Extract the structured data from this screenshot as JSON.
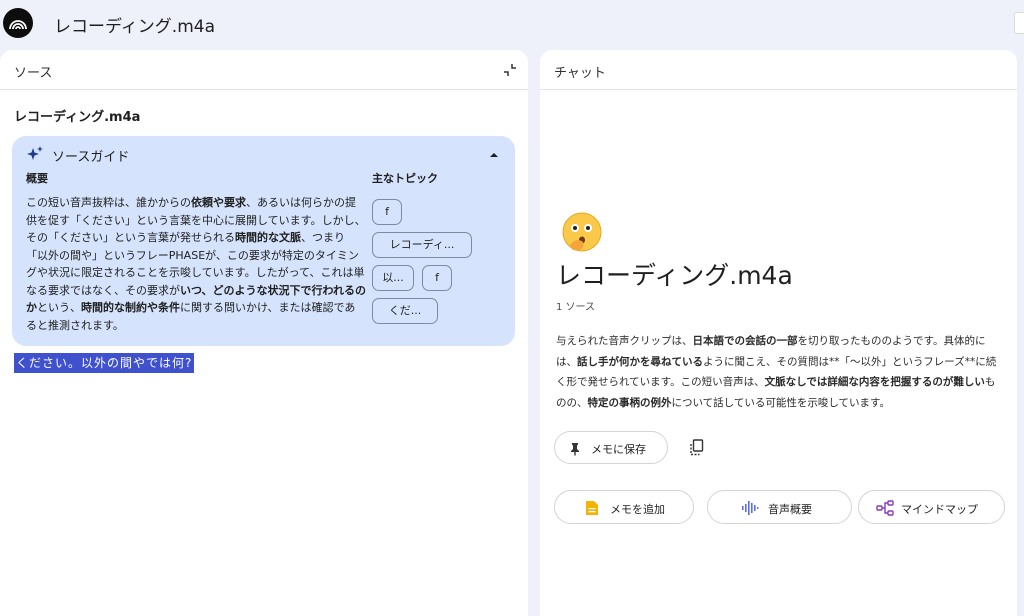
{
  "app": {
    "title": "レコーディング.m4a"
  },
  "source_panel": {
    "title": "ソース",
    "source_name": "レコーディング.m4a",
    "guide": {
      "title": "ソースガイド",
      "overview_label": "概要",
      "overview_parts": [
        {
          "text": "この短い音声抜粋は、誰かからの",
          "bold": false
        },
        {
          "text": "依頼や要求",
          "bold": true
        },
        {
          "text": "、あるいは何らかの提供を促す「ください」という言葉を中心に展開しています。しかし、その「ください」という言葉が発せられる",
          "bold": false
        },
        {
          "text": "時間的な文脈",
          "bold": true
        },
        {
          "text": "、つまり「以外の間や」というフレーPHASEが、この要求が特定のタイミングや状況に限定されることを示唆しています。したがって、これは単なる要求ではなく、その要求が",
          "bold": false
        },
        {
          "text": "いつ、どのような状況下で行われるのか",
          "bold": true
        },
        {
          "text": "という、",
          "bold": false
        },
        {
          "text": "時間的な制約や条件",
          "bold": true
        },
        {
          "text": "に関する問いかけ、または確認であると推測されます。",
          "bold": false
        }
      ],
      "topics_label": "主なトピック",
      "topics": [
        "f",
        "レコーディ...",
        "以...",
        "f",
        "くだ..."
      ]
    },
    "selected_text": "ください。以外の間やでは何?"
  },
  "chat_panel": {
    "title": "チャット",
    "notebook_title": "レコーディング.m4a",
    "source_count": "1 ソース",
    "summary_parts": [
      {
        "text": "与えられた音声クリップは、",
        "bold": false
      },
      {
        "text": "日本語での会話の一部",
        "bold": true
      },
      {
        "text": "を切り取ったもののようです。具体的には、",
        "bold": false
      },
      {
        "text": "話し手が何かを尋ねている",
        "bold": true
      },
      {
        "text": "ように聞こえ、その質問は**「〜以外」というフレーズ**に続く形で発せられています。この短い音声は、",
        "bold": false
      },
      {
        "text": "文脈なしでは詳細な内容を把握するのが難しい",
        "bold": true
      },
      {
        "text": "ものの、",
        "bold": false
      },
      {
        "text": "特定の事柄の例外",
        "bold": true
      },
      {
        "text": "について話している可能性を示唆しています。",
        "bold": false
      }
    ],
    "save_note_label": "メモに保存",
    "actions": [
      {
        "label": "メモを追加",
        "icon": "note-icon"
      },
      {
        "label": "音声概要",
        "icon": "audio-wave-icon"
      },
      {
        "label": "マインドマップ",
        "icon": "mindmap-icon"
      }
    ]
  },
  "colors": {
    "background": "#eef0fa",
    "guide_bg": "#d5e3fc",
    "selection": "#3f51cc",
    "note_icon": "#f2b400",
    "audio_icon": "#5b6ee8",
    "mindmap_icon": "#8a3ab9"
  }
}
